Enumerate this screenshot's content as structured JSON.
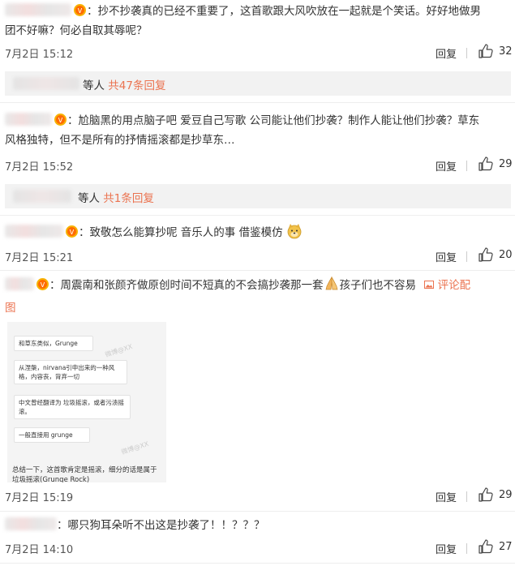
{
  "colors": {
    "accent": "#eb7350",
    "text": "#333333",
    "muted": "#555555",
    "subbg": "#f2f2f2"
  },
  "comments": [
    {
      "text_line1": "：抄不抄袭真的已经不重要了，这首歌跟大风吹放在一起就是个笑话。好好地做男",
      "text_line2": "团不好嘛？何必自取其辱呢？",
      "date": "7月2日 15:12",
      "reply": "回复",
      "likes": "32"
    },
    {
      "text_line1": "：尬脑黑的用点脑子吧 爱豆自己写歌 公司能让他们抄袭？制作人能让他们抄袭？草东",
      "text_line2": "风格独特，但不是所有的抒情摇滚都是抄草东…",
      "date": "7月2日 15:52",
      "reply": "回复",
      "likes": "29"
    },
    {
      "text_line1": "：致敬怎么能算抄呢 音乐人的事 借鉴模仿",
      "date": "7月2日 15:21",
      "reply": "回复",
      "likes": "20"
    },
    {
      "text_line1": "：周震南和张颜齐做原创时间不短真的不会搞抄袭那一套",
      "text_line1b": "孩子们也不容易",
      "report_label": "评论配",
      "text_line2": "图",
      "date": "7月2日 15:19",
      "reply": "回复",
      "likes": "29"
    },
    {
      "text_line1": "：哪只狗耳朵听不出这是抄袭了！！？？？",
      "date": "7月2日 14:10",
      "reply": "回复",
      "likes": "27"
    }
  ],
  "subreplies": [
    {
      "prefix": "等人 ",
      "count": "共47条回复"
    },
    {
      "prefix": "等人 ",
      "count": "共1条回复"
    }
  ],
  "screenshot": {
    "bubbles": [
      "和草东类似，Grunge",
      "从涅槃，nirvana引申出来的一种风格，内容丧，背弃一切",
      "中文曾经翻译为 垃圾摇滚，或者污渍摇滚。",
      "一般直接用 grunge"
    ],
    "summary": "总结一下，这首歌肯定是摇滚，细分的话是属于垃圾摇滚(Grunge Rock)"
  }
}
